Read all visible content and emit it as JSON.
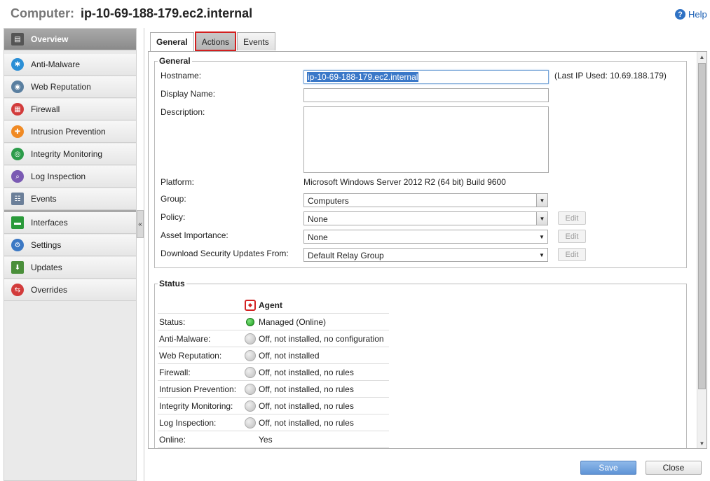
{
  "header": {
    "title_prefix": "Computer:",
    "hostname": "ip-10-69-188-179.ec2.internal",
    "help_label": "Help"
  },
  "sidebar": {
    "collapse_label": "«",
    "items": [
      {
        "label": "Overview",
        "icon": "overview-icon",
        "color": "#555555"
      },
      {
        "label": "Anti-Malware",
        "icon": "anti-malware-icon",
        "color": "#2b8fd6"
      },
      {
        "label": "Web Reputation",
        "icon": "web-reputation-icon",
        "color": "#5a7fa0"
      },
      {
        "label": "Firewall",
        "icon": "firewall-icon",
        "color": "#d23b3b"
      },
      {
        "label": "Intrusion Prevention",
        "icon": "intrusion-prevention-icon",
        "color": "#f08a24"
      },
      {
        "label": "Integrity Monitoring",
        "icon": "integrity-monitoring-icon",
        "color": "#2c9c4a"
      },
      {
        "label": "Log Inspection",
        "icon": "log-inspection-icon",
        "color": "#7a5ab3"
      },
      {
        "label": "Events",
        "icon": "events-icon",
        "color": "#6b7f99"
      },
      {
        "label": "Interfaces",
        "icon": "interfaces-icon",
        "color": "#2a9a3a"
      },
      {
        "label": "Settings",
        "icon": "settings-icon",
        "color": "#3b78c4"
      },
      {
        "label": "Updates",
        "icon": "updates-icon",
        "color": "#4a8f3a"
      },
      {
        "label": "Overrides",
        "icon": "overrides-icon",
        "color": "#d23b3b"
      }
    ]
  },
  "tabs": [
    {
      "label": "General"
    },
    {
      "label": "Actions"
    },
    {
      "label": "Events"
    }
  ],
  "general": {
    "legend": "General",
    "hostname_label": "Hostname:",
    "hostname_value": "ip-10-69-188-179.ec2.internal",
    "last_ip": "(Last IP Used: 10.69.188.179)",
    "display_name_label": "Display Name:",
    "display_name_value": "",
    "description_label": "Description:",
    "platform_label": "Platform:",
    "platform_value": "Microsoft Windows Server 2012 R2 (64 bit) Build 9600",
    "group_label": "Group:",
    "group_value": "Computers",
    "policy_label": "Policy:",
    "policy_value": "None",
    "asset_label": "Asset Importance:",
    "asset_value": "None",
    "download_label": "Download Security Updates From:",
    "download_value": "Default Relay Group",
    "edit_label": "Edit"
  },
  "status": {
    "legend": "Status",
    "agent_header": "Agent",
    "rows": [
      {
        "key": "Status:",
        "value": "Managed (Online)",
        "icon": "online-status-icon"
      },
      {
        "key": "Anti-Malware:",
        "value": "Off, not installed, no configuration",
        "icon": "anti-malware-status-icon"
      },
      {
        "key": "Web Reputation:",
        "value": "Off, not installed",
        "icon": "web-reputation-status-icon"
      },
      {
        "key": "Firewall:",
        "value": "Off, not installed, no rules",
        "icon": "firewall-status-icon"
      },
      {
        "key": "Intrusion Prevention:",
        "value": "Off, not installed, no rules",
        "icon": "intrusion-prevention-status-icon"
      },
      {
        "key": "Integrity Monitoring:",
        "value": "Off, not installed, no rules",
        "icon": "integrity-monitoring-status-icon"
      },
      {
        "key": "Log Inspection:",
        "value": "Off, not installed, no rules",
        "icon": "log-inspection-status-icon"
      },
      {
        "key": "Online:",
        "value": "Yes",
        "icon": ""
      }
    ]
  },
  "footer": {
    "save_label": "Save",
    "close_label": "Close"
  }
}
